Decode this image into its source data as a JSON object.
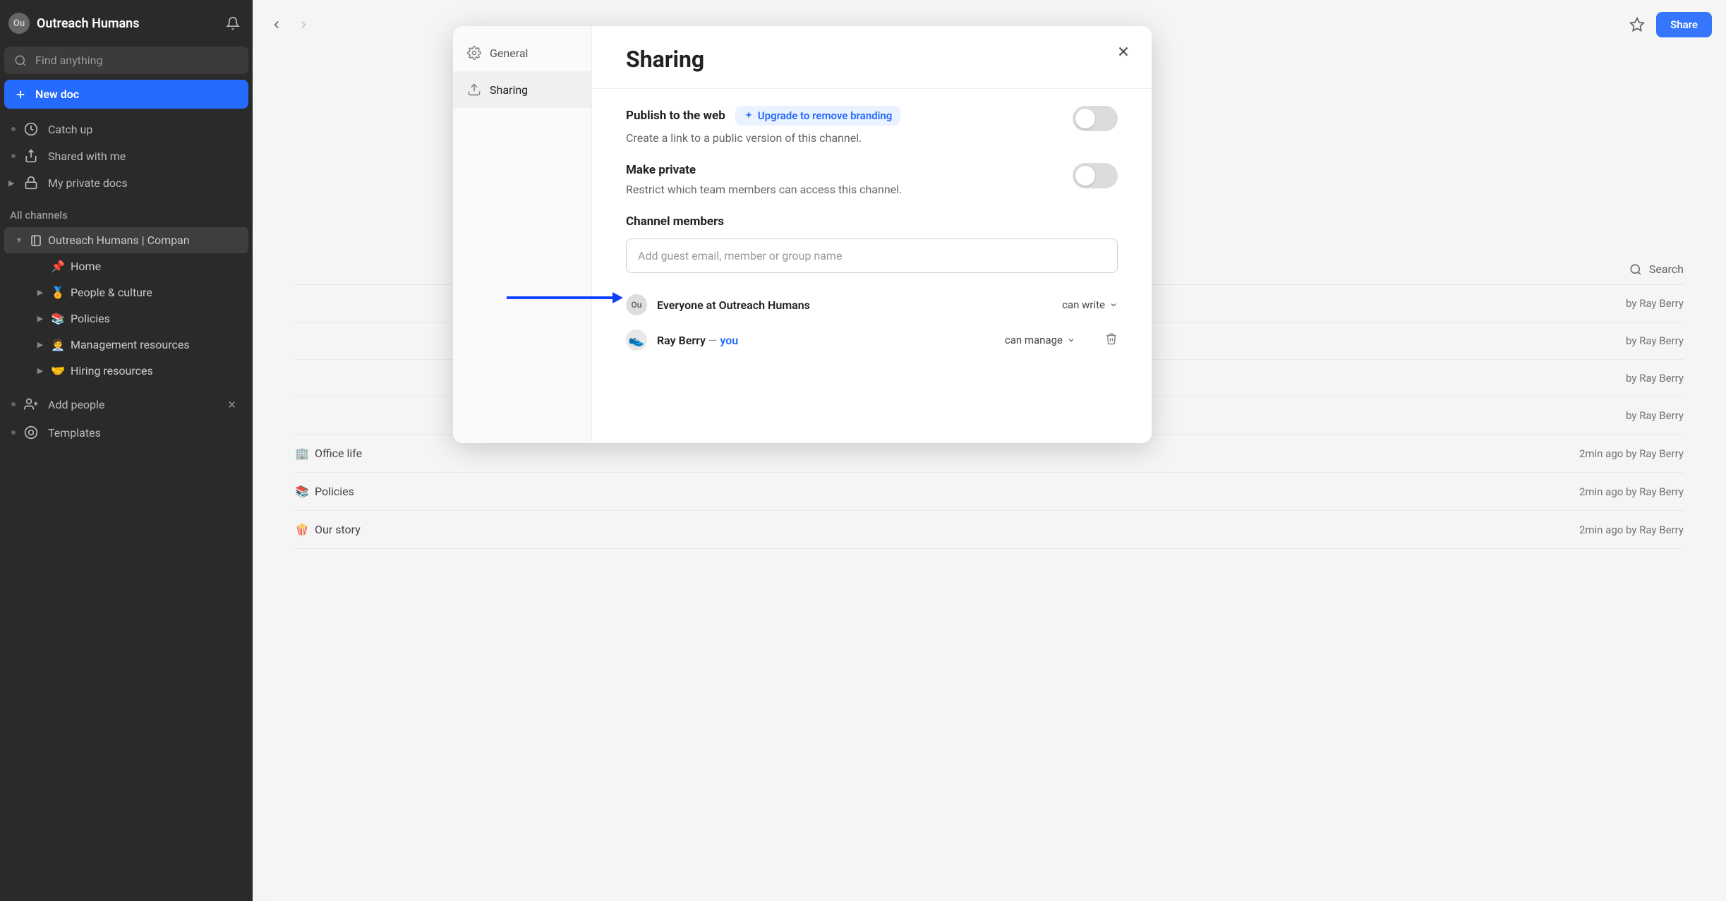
{
  "workspace": {
    "avatar_initials": "Ou",
    "name": "Outreach Humans"
  },
  "search": {
    "placeholder": "Find anything"
  },
  "new_doc_label": "New doc",
  "nav": {
    "catch_up": "Catch up",
    "shared": "Shared with me",
    "private": "My private docs"
  },
  "channels_label": "All channels",
  "tree": {
    "root": "Outreach Humans | Compan",
    "children": [
      {
        "emoji": "📌",
        "label": "Home"
      },
      {
        "emoji": "🏅",
        "label": "People & culture"
      },
      {
        "emoji": "📚",
        "label": "Policies"
      },
      {
        "emoji": "🧑‍💼",
        "label": "Management resources"
      },
      {
        "emoji": "🤝",
        "label": "Hiring resources"
      }
    ]
  },
  "bottom": {
    "add_people": "Add people",
    "templates": "Templates"
  },
  "topbar": {
    "share": "Share"
  },
  "doc_list": {
    "search_label": "Search",
    "rows": [
      {
        "emoji": "",
        "title": "",
        "meta": "by Ray Berry"
      },
      {
        "emoji": "",
        "title": "",
        "meta": "by Ray Berry"
      },
      {
        "emoji": "",
        "title": "",
        "meta": "by Ray Berry"
      },
      {
        "emoji": "",
        "title": "",
        "meta": "by Ray Berry"
      },
      {
        "emoji": "🏢",
        "title": "Office life",
        "meta": "2min ago by Ray Berry"
      },
      {
        "emoji": "📚",
        "title": "Policies",
        "meta": "2min ago by Ray Berry"
      },
      {
        "emoji": "🍿",
        "title": "Our story",
        "meta": "2min ago by Ray Berry"
      }
    ]
  },
  "modal": {
    "tabs": {
      "general": "General",
      "sharing": "Sharing"
    },
    "title": "Sharing",
    "publish": {
      "label": "Publish to the web",
      "upgrade": "Upgrade to remove branding",
      "desc": "Create a link to a public version of this channel."
    },
    "private": {
      "label": "Make private",
      "desc": "Restrict which team members can access this channel."
    },
    "members": {
      "heading": "Channel members",
      "input_placeholder": "Add guest email, member or group name",
      "list": [
        {
          "avatar": "Ou",
          "avatar_type": "org",
          "name": "Everyone at Outreach Humans",
          "perm": "can write"
        },
        {
          "avatar": "👟",
          "avatar_type": "user",
          "name": "Ray Berry",
          "you_label": "you",
          "perm": "can manage",
          "removable": true
        }
      ]
    }
  }
}
